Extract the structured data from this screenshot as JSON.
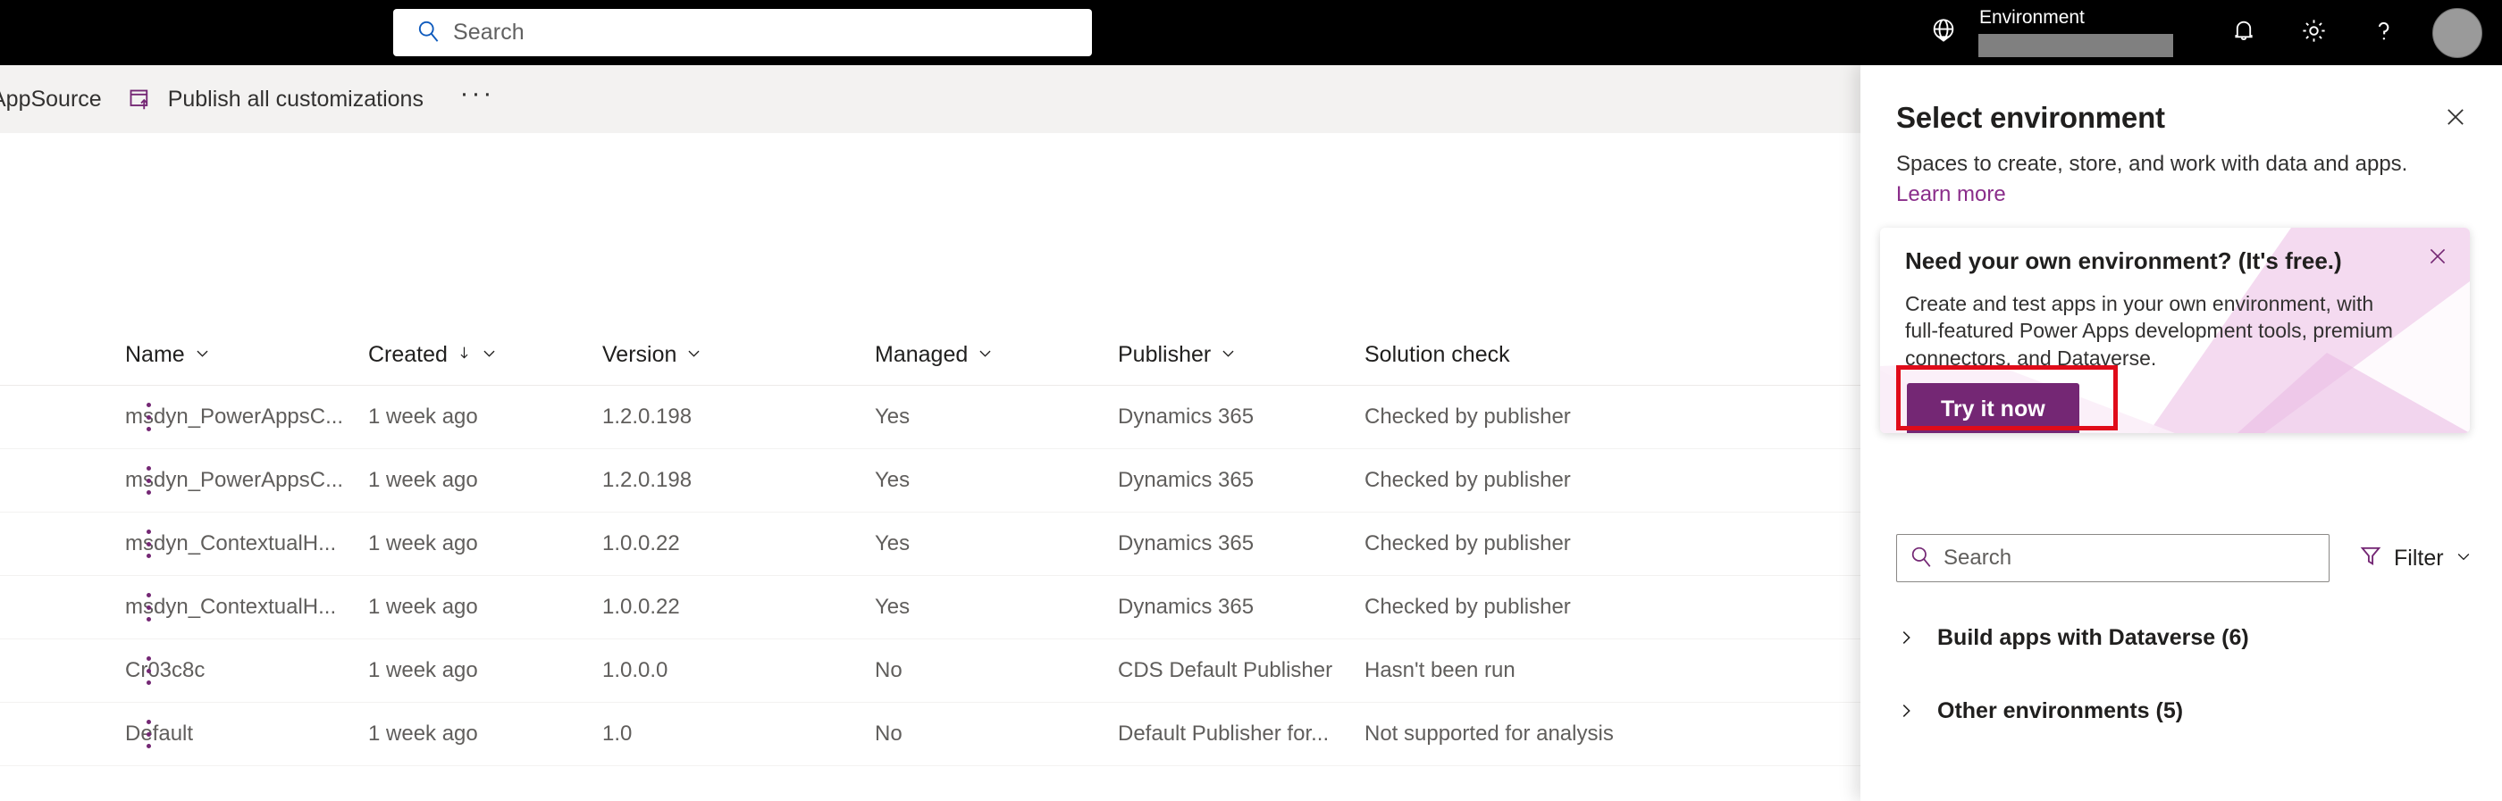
{
  "topbar": {
    "search": {
      "placeholder": "Search",
      "icon": "search-icon"
    },
    "waffle_icon": "globe-icon",
    "environment_label": "Environment",
    "notifications_icon": "bell-icon",
    "settings_icon": "gear-icon",
    "help_icon": "help-icon",
    "avatar": "avatar"
  },
  "commandbar": {
    "appsource_label": "AppSource",
    "publish_label": "Publish all customizations",
    "publish_icon": "publish-icon",
    "overflow_label": "···"
  },
  "grid": {
    "columns": [
      {
        "label": "Name",
        "sortable": true,
        "sorted": false
      },
      {
        "label": "Created",
        "sortable": true,
        "sorted": true
      },
      {
        "label": "Version",
        "sortable": true,
        "sorted": false
      },
      {
        "label": "Managed",
        "sortable": true,
        "sorted": false
      },
      {
        "label": "Publisher",
        "sortable": true,
        "sorted": false
      },
      {
        "label": "Solution check",
        "sortable": false,
        "sorted": false
      }
    ],
    "rows": [
      {
        "name": "msdyn_PowerAppsC...",
        "created": "1 week ago",
        "version": "1.2.0.198",
        "managed": "Yes",
        "publisher": "Dynamics 365",
        "check": "Checked by publisher"
      },
      {
        "name": "msdyn_PowerAppsC...",
        "created": "1 week ago",
        "version": "1.2.0.198",
        "managed": "Yes",
        "publisher": "Dynamics 365",
        "check": "Checked by publisher"
      },
      {
        "name": "msdyn_ContextualH...",
        "created": "1 week ago",
        "version": "1.0.0.22",
        "managed": "Yes",
        "publisher": "Dynamics 365",
        "check": "Checked by publisher"
      },
      {
        "name": "msdyn_ContextualH...",
        "created": "1 week ago",
        "version": "1.0.0.22",
        "managed": "Yes",
        "publisher": "Dynamics 365",
        "check": "Checked by publisher"
      },
      {
        "name": "Cr03c8c",
        "created": "1 week ago",
        "version": "1.0.0.0",
        "managed": "No",
        "publisher": "CDS Default Publisher",
        "check": "Hasn't been run"
      },
      {
        "name": "Default",
        "created": "1 week ago",
        "version": "1.0",
        "managed": "No",
        "publisher": "Default Publisher for...",
        "check": "Not supported for analysis"
      }
    ]
  },
  "panel": {
    "title": "Select environment",
    "subtitle": "Spaces to create, store, and work with data and apps.",
    "learn_more": "Learn more",
    "close_icon": "close-icon",
    "callout": {
      "title": "Need your own environment? (It's free.)",
      "body": "Create and test apps in your own environment, with full-featured Power Apps development tools, premium connectors, and Dataverse.",
      "button": "Try it now",
      "close_icon": "close-icon"
    },
    "search": {
      "placeholder": "Search",
      "icon": "search-icon"
    },
    "filter": {
      "label": "Filter",
      "icon": "filter-icon"
    },
    "groups": [
      {
        "label": "Build apps with Dataverse (6)",
        "expanded": false
      },
      {
        "label": "Other environments (5)",
        "expanded": false
      }
    ]
  },
  "colors": {
    "brand_purple": "#742774",
    "link_purple": "#8a2d8a",
    "highlight_red": "#e00c1a",
    "topbar_black": "#000000",
    "commandbar_gray": "#f3f2f1"
  }
}
